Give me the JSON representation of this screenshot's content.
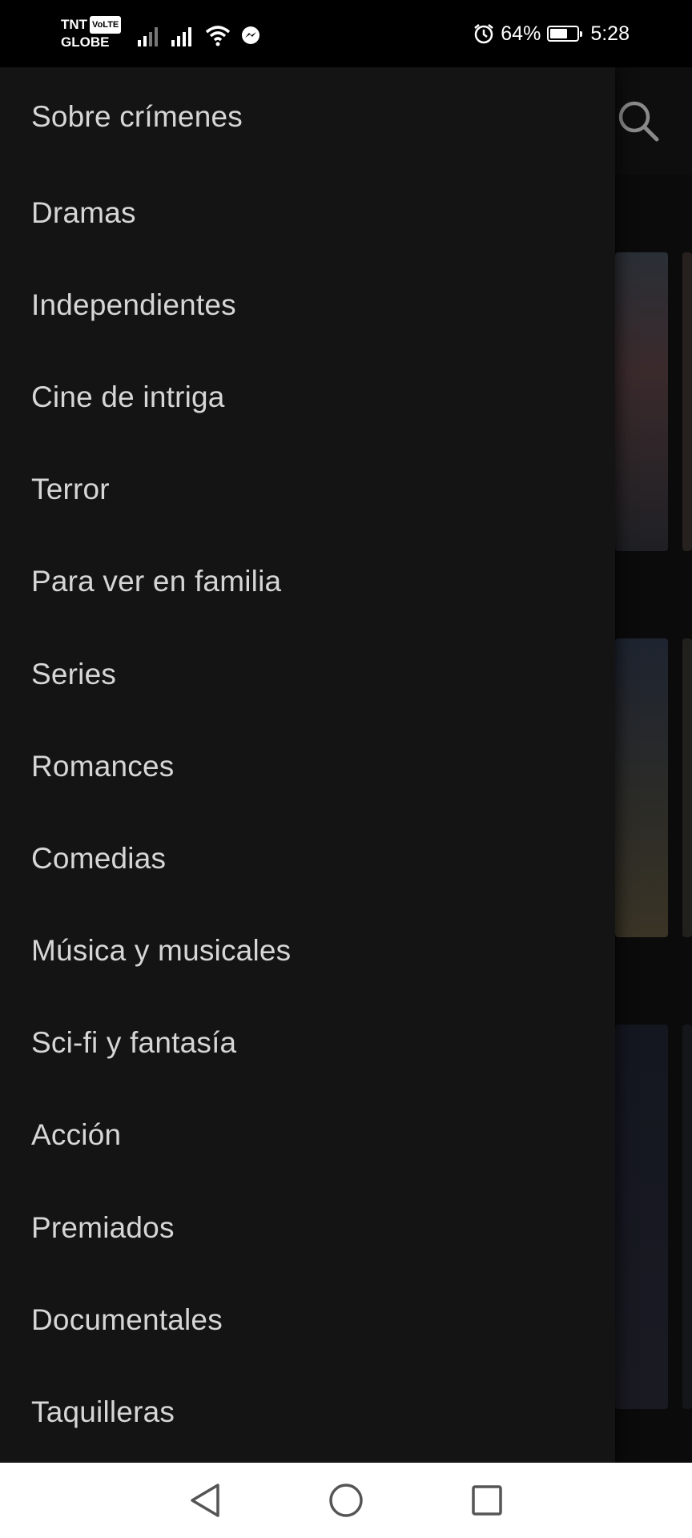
{
  "status_bar": {
    "carrier_line1": "TNT",
    "volte_badge": "VoLTE",
    "carrier_line2": "GLOBE",
    "battery_percent": "64%",
    "battery_level": 0.64,
    "time": "5:28",
    "icons": [
      "signal-icon",
      "signal-icon",
      "wifi-icon",
      "messenger-icon",
      "alarm-icon",
      "battery-icon"
    ]
  },
  "drawer": {
    "items": [
      {
        "label": "Sobre crímenes"
      },
      {
        "label": "Dramas"
      },
      {
        "label": "Independientes"
      },
      {
        "label": "Cine de intriga"
      },
      {
        "label": "Terror"
      },
      {
        "label": "Para ver en familia"
      },
      {
        "label": "Series"
      },
      {
        "label": "Romances"
      },
      {
        "label": "Comedias"
      },
      {
        "label": "Música y musicales"
      },
      {
        "label": "Sci-fi y fantasía"
      },
      {
        "label": "Acción"
      },
      {
        "label": "Premiados"
      },
      {
        "label": "Documentales"
      },
      {
        "label": "Taquilleras"
      }
    ]
  },
  "background": {
    "search_icon": "search-icon"
  },
  "nav_bar": {
    "icons": [
      "back-icon",
      "home-icon",
      "recents-icon"
    ]
  },
  "colors": {
    "drawer_bg": "#141414",
    "menu_text": "#d6d6d6",
    "nav_bg": "#ffffff"
  }
}
